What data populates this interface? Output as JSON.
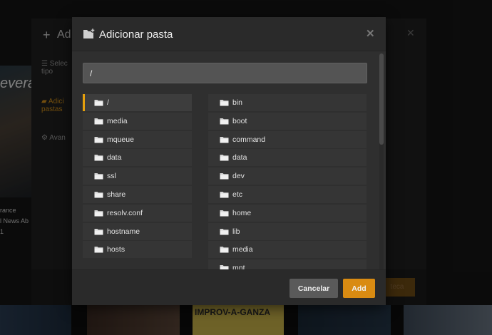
{
  "background": {
    "poster_title": "evera",
    "poster_lines": [
      "rance",
      "l News Ab",
      "1"
    ],
    "thumb_text": "IMPROV-A-GANZA"
  },
  "outer_dialog": {
    "title": "Ad",
    "side_items": [
      {
        "label": "Selec",
        "sub": "tipo",
        "active": false
      },
      {
        "label": "Adici",
        "sub": "pastas",
        "active": true
      },
      {
        "label": "Avan",
        "sub": "",
        "active": false
      }
    ],
    "save_label": "teca"
  },
  "modal": {
    "title": "Adicionar pasta",
    "close_icon": "close-icon",
    "path_value": "/",
    "left_folders": [
      "/",
      "media",
      "mqueue",
      "data",
      "ssl",
      "share",
      "resolv.conf",
      "hostname",
      "hosts"
    ],
    "right_folders": [
      "bin",
      "boot",
      "command",
      "data",
      "dev",
      "etc",
      "home",
      "lib",
      "media",
      "mnt"
    ],
    "selected_left_index": 0,
    "cancel_label": "Cancelar",
    "add_label": "Add"
  },
  "colors": {
    "accent": "#e5a00d",
    "add_button": "#d98b12",
    "cancel_button": "#5a5a5a"
  }
}
